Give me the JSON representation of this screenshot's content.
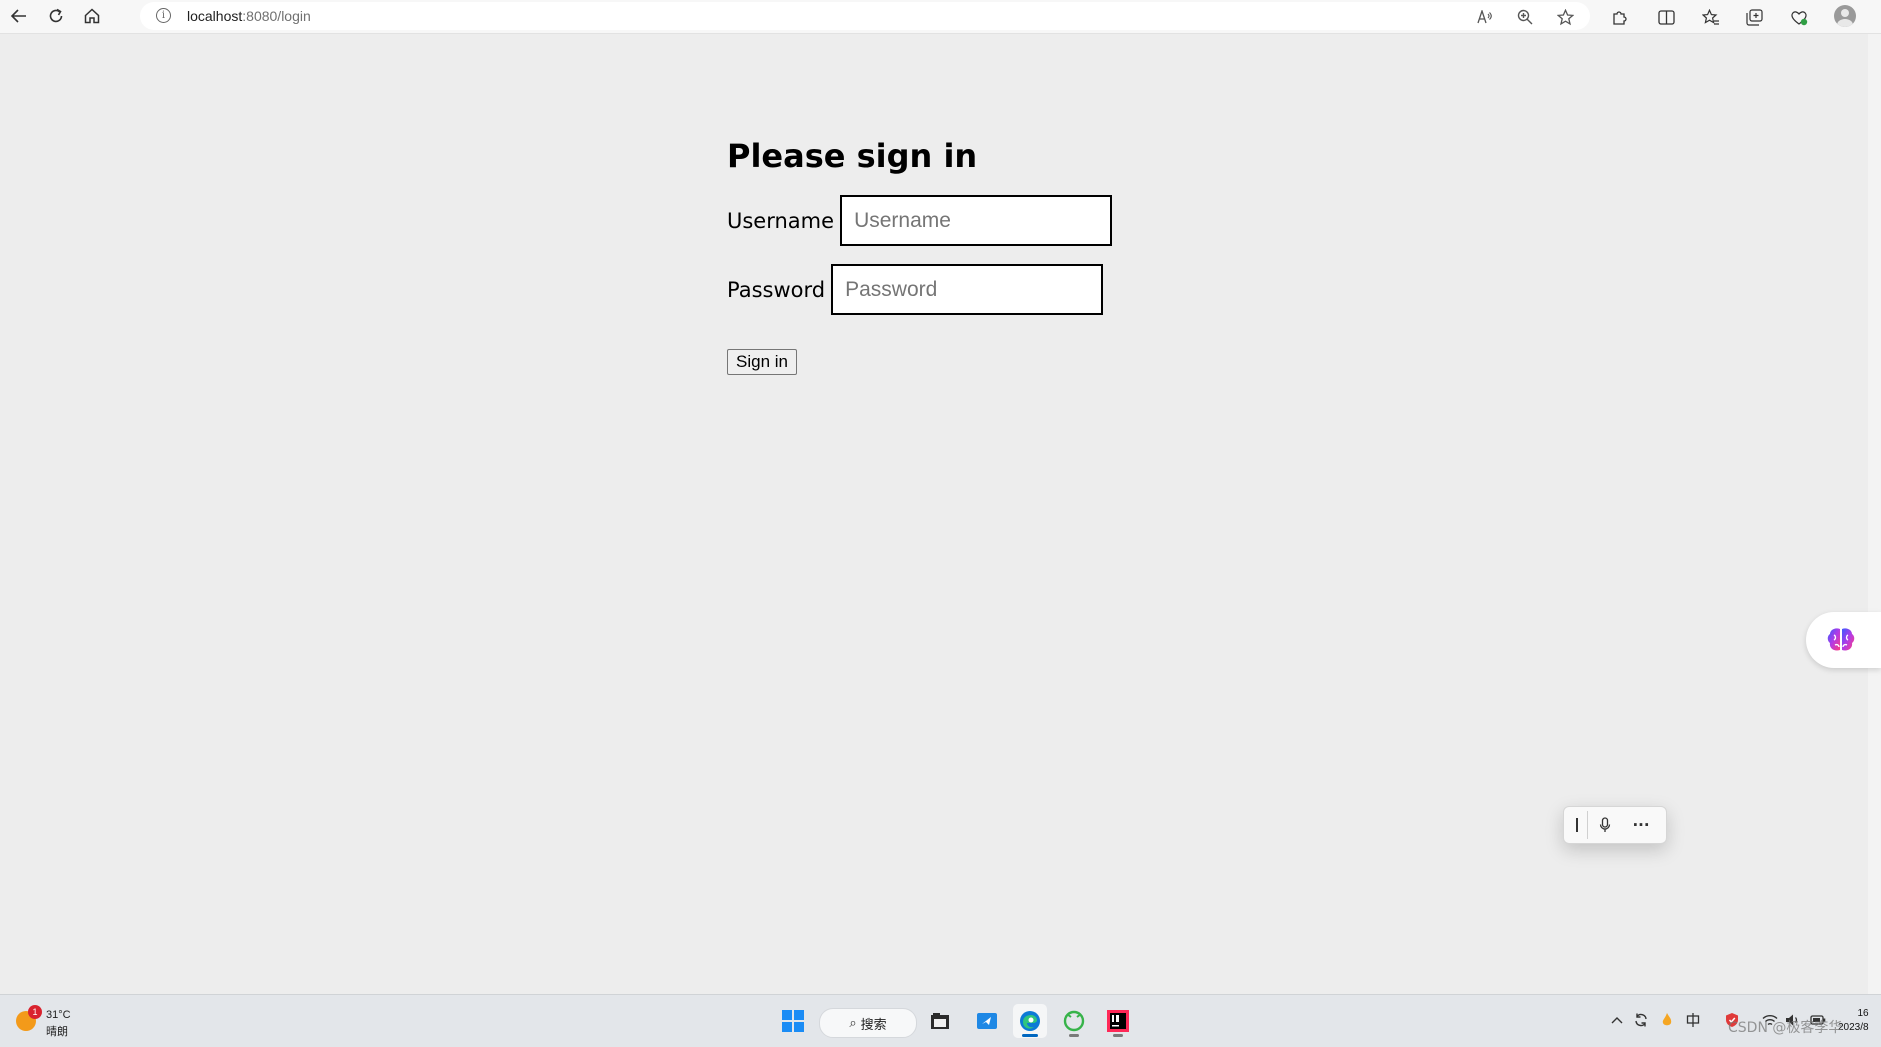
{
  "browser": {
    "url_host": "localhost",
    "url_path": ":8080/login",
    "icons": {
      "back": "back-arrow-icon",
      "refresh": "refresh-icon",
      "home": "home-icon",
      "site_info": "info-icon",
      "read_aloud": "read-aloud-icon",
      "zoom": "zoom-icon",
      "favorite": "star-icon",
      "extensions": "puzzle-icon",
      "split_screen": "split-screen-icon",
      "favorites": "favorites-icon",
      "collections": "collections-icon",
      "browser_essentials": "heart-shield-icon",
      "profile": "profile-avatar-icon"
    }
  },
  "login": {
    "heading": "Please sign in",
    "username_label": "Username",
    "username_placeholder": "Username",
    "username_value": "",
    "password_label": "Password",
    "password_placeholder": "Password",
    "password_value": "",
    "submit_label": "Sign in"
  },
  "taskbar": {
    "weather_temp": "31°C",
    "weather_condition": "晴朗",
    "weather_badge": "1",
    "search_label": "搜索",
    "clock_time": "16",
    "clock_date": "2023/8"
  },
  "watermark": "CSDN @极客李华",
  "colors": {
    "page_background": "#ededed",
    "windows_blue": "#1b8cf5",
    "edge_accent": "#0067c0"
  }
}
